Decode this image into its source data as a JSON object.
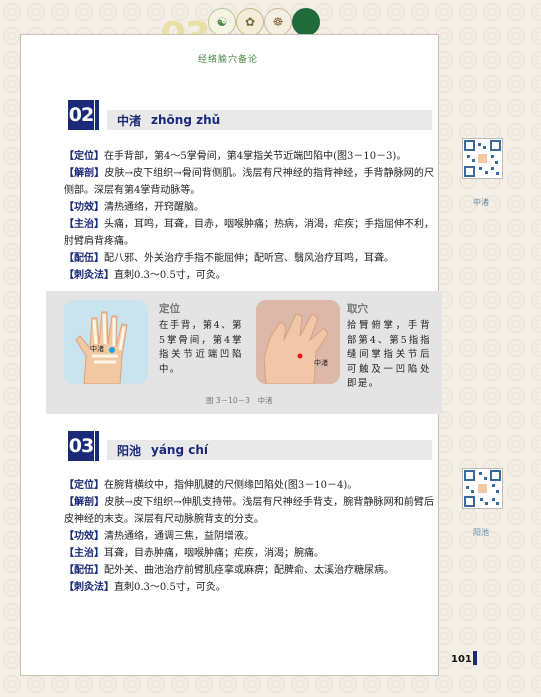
{
  "header": {
    "chapter_number": "03",
    "title": "经络腧穴备论"
  },
  "sections": [
    {
      "number": "02",
      "name": "中渚",
      "pinyin": "zhōng zhǔ",
      "items": [
        {
          "label": "【定位】",
          "text": "在手背部，第4～5掌骨间，第4掌指关节近端凹陷中(图3－10－3)。"
        },
        {
          "label": "【解剖】",
          "text": "皮肤→皮下组织→骨间背侧肌。浅层有尺神经的指背神经，手背静脉网的尺侧部。深层有第4掌背动脉等。"
        },
        {
          "label": "【功效】",
          "text": "清热通络，开窍醒脑。"
        },
        {
          "label": "【主治】",
          "text": "头痛，耳鸣，耳聋，目赤，咽喉肿痛；热病，消渴，疟疾；手指屈伸不利，肘臂肩背疼痛。"
        },
        {
          "label": "【配伍】",
          "text": "配八邪、外关治疗手指不能屈伸；配听宫、翳风治疗耳鸣，耳聋。"
        },
        {
          "label": "【刺灸法】",
          "text": "直刺0.3～0.5寸，可灸。"
        }
      ],
      "qr_label": "中渚"
    },
    {
      "number": "03",
      "name": "阳池",
      "pinyin": "yáng chí",
      "items": [
        {
          "label": "【定位】",
          "text": "在腕背横纹中，指伸肌腱的尺侧缘凹陷处(图3－10－4)。"
        },
        {
          "label": "【解剖】",
          "text": "皮肤→皮下组织→伸肌支持带。浅层有尺神经手背支，腕背静脉网和前臂后皮神经的末支。深层有尺动脉腕背支的分支。"
        },
        {
          "label": "【功效】",
          "text": "清热通络，通调三焦，益阴增液。"
        },
        {
          "label": "【主治】",
          "text": "耳聋，目赤肿痛，咽喉肿痛；疟疾，消渴；腕痛。"
        },
        {
          "label": "【配伍】",
          "text": "配外关、曲池治疗前臂肌痉挛或麻痹；配脾俞、太溪治疗糖尿病。"
        },
        {
          "label": "【刺灸法】",
          "text": "直刺0.3～0.5寸，可灸。"
        }
      ],
      "qr_label": "阳池"
    }
  ],
  "figure": {
    "locate_heading": "定位",
    "locate_text": "在手背，第4、第5掌骨间，第4掌指关节近端凹陷中。",
    "locate_marker": "中渚",
    "take_heading": "取穴",
    "take_text": "拾臂俯掌，手背部第4、第5指指缝间掌指关节后可触及一凹陷处即是。",
    "take_marker": "中渚",
    "caption": "图 3－10－3　中渚"
  },
  "page_number": "101",
  "colors": {
    "accent": "#1b2a78",
    "qr_label": "#5a8ab0",
    "title_green": "#4a8a4a"
  }
}
